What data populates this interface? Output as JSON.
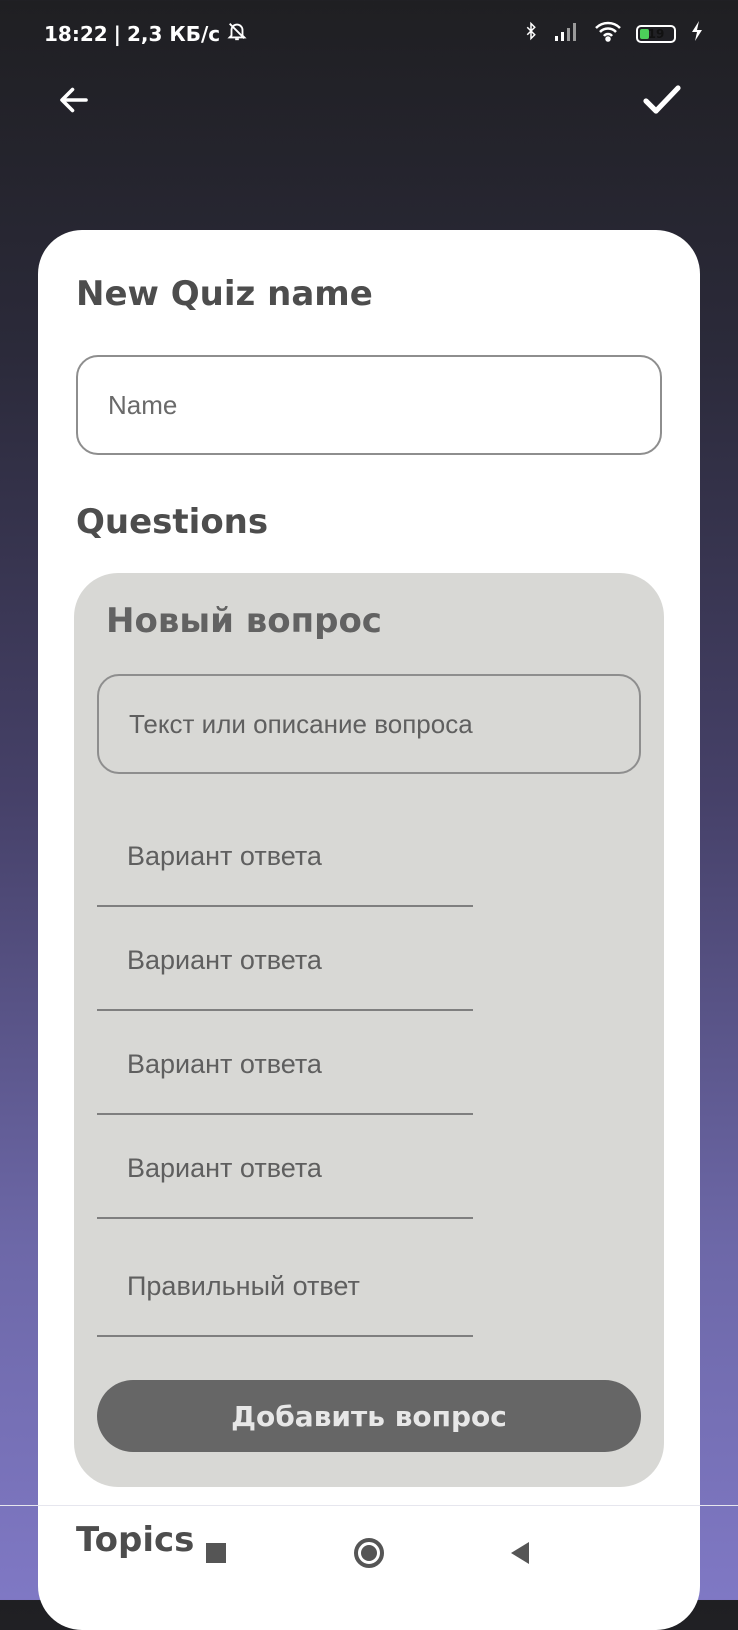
{
  "status_bar": {
    "time": "18:22",
    "separator": "|",
    "network_speed": "2,3 КБ/с",
    "battery_level": "19",
    "icons": [
      "bell-off-icon",
      "bluetooth-icon",
      "signal-icon",
      "wifi-icon",
      "battery-icon",
      "charging-icon"
    ]
  },
  "top_bar": {
    "back_icon": "arrow-left-icon",
    "confirm_icon": "check-icon"
  },
  "form": {
    "quiz_name_label": "New Quiz name",
    "name_placeholder": "Name",
    "questions_label": "Questions",
    "question_card": {
      "title": "Новый вопрос",
      "question_text_placeholder": "Текст или описание вопроса",
      "answers": [
        "Вариант ответа",
        "Вариант ответа",
        "Вариант ответа",
        "Вариант ответа"
      ],
      "correct_answer_placeholder": "Правильный ответ",
      "add_button_label": "Добавить вопрос"
    },
    "topics_label": "Topics"
  },
  "navigation": {
    "items": [
      "recents-icon",
      "home-icon",
      "back-icon"
    ]
  },
  "colors": {
    "card_bg": "#ffffff",
    "question_card_bg": "#d8d8d5",
    "button_bg": "#666666",
    "gradient_top": "#1f1f22",
    "gradient_bottom": "#7f78c4"
  }
}
